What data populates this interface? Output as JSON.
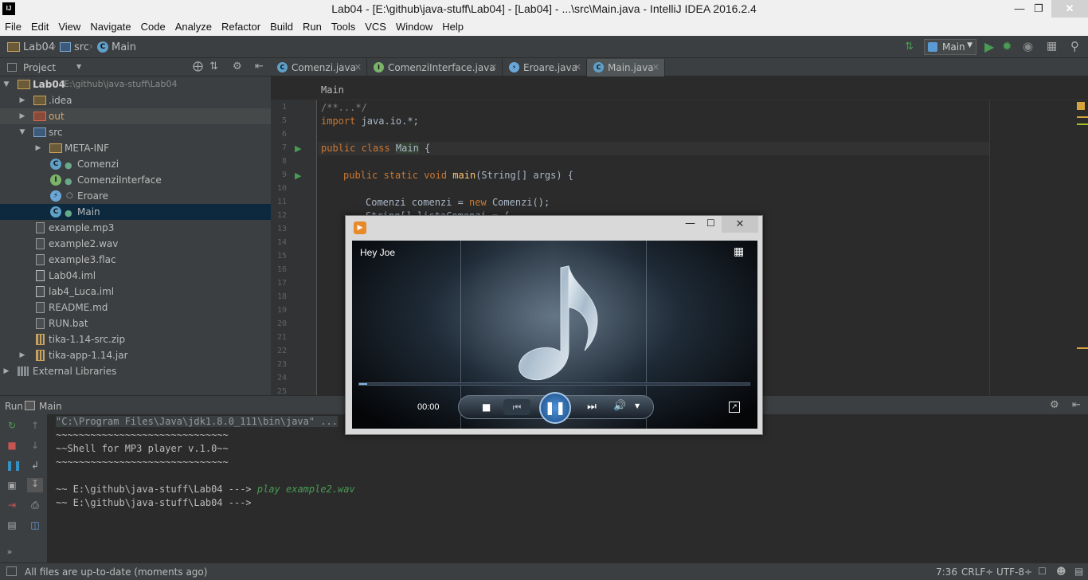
{
  "window": {
    "title": "Lab04 - [E:\\github\\java-stuff\\Lab04] - [Lab04] - ...\\src\\Main.java - IntelliJ IDEA 2016.2.4",
    "logo": "IJ"
  },
  "menu": [
    "File",
    "Edit",
    "View",
    "Navigate",
    "Code",
    "Analyze",
    "Refactor",
    "Build",
    "Run",
    "Tools",
    "VCS",
    "Window",
    "Help"
  ],
  "nav": {
    "crumbs": [
      "Lab04",
      "src",
      "Main"
    ],
    "run_config": "Main"
  },
  "project": {
    "header": "Project",
    "root": {
      "name": "Lab04",
      "path": "E:\\github\\java-stuff\\Lab04"
    },
    "items": [
      ".idea",
      "out",
      "src",
      "META-INF",
      "Comenzi",
      "ComenziInterface",
      "Eroare",
      "Main",
      "example.mp3",
      "example2.wav",
      "example3.flac",
      "Lab04.iml",
      "lab4_Luca.iml",
      "README.md",
      "RUN.bat",
      "tika-1.14-src.zip",
      "tika-app-1.14.jar",
      "External Libraries"
    ]
  },
  "tabs": [
    "Comenzi.java",
    "ComenziInterface.java",
    "Eroare.java",
    "Main.java"
  ],
  "editor": {
    "breadcrumb": "Main",
    "line_numbers": [
      "1",
      "5",
      "6",
      "7",
      "8",
      "9",
      "10",
      "11",
      "12",
      "13",
      "14",
      "15",
      "16",
      "17",
      "18",
      "19",
      "20",
      "21",
      "22",
      "23",
      "24",
      "25"
    ],
    "code": {
      "l1": "/**...*/",
      "l5a": "import",
      "l5b": " java.io.*;",
      "l7a": "public class ",
      "l7b": "Main",
      "l7c": " {",
      "l9a": "public static void ",
      "l9b": "main",
      "l9c": "(String[] args) {",
      "l11a": "Comenzi comenzi = ",
      "l11b": "new ",
      "l11c": "Comenzi();",
      "l12": "String[] listaComenzi = {"
    }
  },
  "run": {
    "tab_label": "Run",
    "config": "Main",
    "console": {
      "line1": "\"C:\\Program Files\\Java\\jdk1.8.0_111\\bin\\java\" ...",
      "line2": "~~~~~~~~~~~~~~~~~~~~~~~~~~~~~~",
      "line3": "~~Shell for MP3 player v.1.0~~",
      "line4": "~~~~~~~~~~~~~~~~~~~~~~~~~~~~~~",
      "prompt1": "~~ E:\\github\\java-stuff\\Lab04 ---> ",
      "cmd1": "play example2.wav",
      "prompt2": "~~ E:\\github\\java-stuff\\Lab04 --->"
    }
  },
  "status": {
    "message": "All files are up-to-date (moments ago)",
    "position": "7:36",
    "line_sep": "CRLF÷",
    "encoding": "UTF-8÷"
  },
  "player": {
    "track": "Hey Joe",
    "time": "00:00",
    "progress": 0.02
  },
  "colors": {
    "accent": "#3592c4",
    "run_green": "#499c54",
    "stop_red": "#c75450"
  }
}
